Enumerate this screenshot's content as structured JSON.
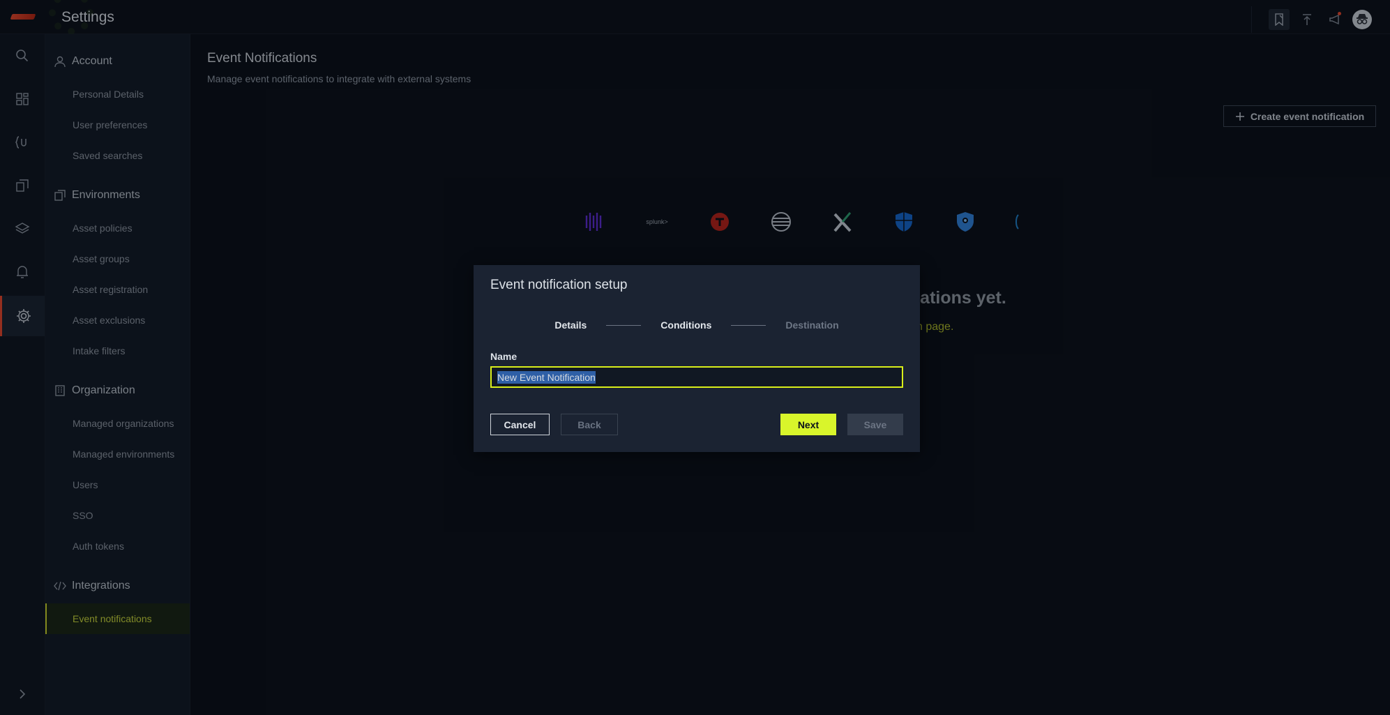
{
  "app": {
    "title": "Settings"
  },
  "header": {
    "icons": [
      "bookmark-icon",
      "upload-icon",
      "megaphone-icon",
      "incognito-avatar"
    ]
  },
  "rail": {
    "items": [
      "search-icon",
      "dashboard-icon",
      "query-icon",
      "reports-icon",
      "layers-icon",
      "bell-icon",
      "gear-icon"
    ],
    "expand": "chevron-right-icon"
  },
  "sidebar": {
    "account": {
      "title": "Account",
      "items": [
        "Personal Details",
        "User preferences",
        "Saved searches"
      ]
    },
    "environments": {
      "title": "Environments",
      "items": [
        "Asset policies",
        "Asset groups",
        "Asset registration",
        "Asset exclusions",
        "Intake filters"
      ]
    },
    "organization": {
      "title": "Organization",
      "items": [
        "Managed organizations",
        "Managed environments",
        "Users",
        "SSO",
        "Auth tokens"
      ]
    },
    "integrations": {
      "title": "Integrations",
      "items": [
        "Event notifications"
      ]
    }
  },
  "main": {
    "title": "Event Notifications",
    "subtitle": "Manage event notifications to integrate with external systems",
    "create_button": "Create event notification",
    "brands": [
      "splunk>"
    ],
    "empty_title": "fications yet.",
    "empty_link": "n page."
  },
  "modal": {
    "title": "Event notification setup",
    "steps": [
      "Details",
      "Conditions",
      "Destination"
    ],
    "name_label": "Name",
    "name_value": "New Event Notification",
    "cancel": "Cancel",
    "back": "Back",
    "next": "Next",
    "save": "Save"
  },
  "colors": {
    "accent": "#d9f52b",
    "brand_red": "#e2462b",
    "background": "#0a0f18"
  }
}
